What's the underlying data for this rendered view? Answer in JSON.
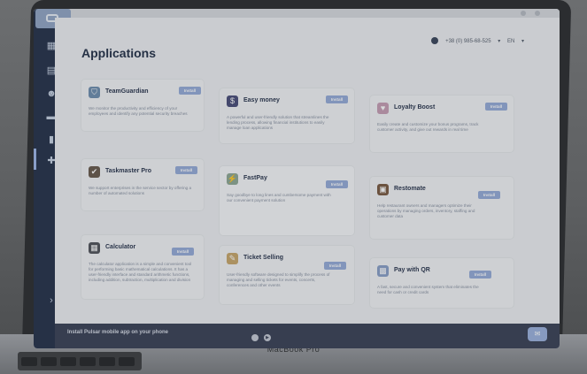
{
  "header": {
    "phone": "+38 (0) 985-68-525",
    "language": "EN"
  },
  "page": {
    "title": "Applications"
  },
  "apps": [
    {
      "name": "TeamGuardian",
      "desc": "We monitor the productivity and efficiency of your employees and identify any potential security breaches",
      "install": "Install",
      "icon": "shield-person-icon",
      "color": "#6f8fb0"
    },
    {
      "name": "Easy money",
      "desc": "A powerful and user-friendly solution that streamlines the lending process, allowing financial institutions to easily manage loan applications",
      "install": "Install",
      "icon": "money-icon",
      "color": "#4b4f7a"
    },
    {
      "name": "Loyalty Boost",
      "desc": "Easily create and customize your bonus programs, track customer activity, and give out rewards in real time",
      "install": "Install",
      "icon": "loyalty-icon",
      "color": "#c79fb5"
    },
    {
      "name": "Taskmaster Pro",
      "desc": "We support enterprises in the service sector by offering a number of automated solutions",
      "install": "Install",
      "icon": "tasks-icon",
      "color": "#6a5b4d"
    },
    {
      "name": "FastPay",
      "desc": "Say goodbye to long lines and cumbersome payment with our convenient payment solution",
      "install": "Install",
      "icon": "fastpay-icon",
      "color": "#8fa995"
    },
    {
      "name": "Restomate",
      "desc": "Help restaurant owners and managers optimize their operations by managing orders, inventory, staffing and customer data",
      "install": "Install",
      "icon": "restaurant-icon",
      "color": "#7a5b43"
    },
    {
      "name": "Calculator",
      "desc": "The calculator application is a simple and convenient tool for performing basic mathematical calculations. It has a user-friendly interface and standard arithmetic functions, including addition, subtraction, multiplication and division",
      "install": "Install",
      "icon": "calculator-icon",
      "color": "#52555c"
    },
    {
      "name": "Ticket Selling",
      "desc": "User-friendly software designed to simplify the process of managing and selling tickets for events, concerts, conferences and other events",
      "install": "Install",
      "icon": "ticket-icon",
      "color": "#c9a86c"
    },
    {
      "name": "Pay with QR",
      "desc": "A fast, secure and convenient system that eliminates the need for cash or credit cards",
      "install": "Install",
      "icon": "qr-icon",
      "color": "#8aa0c9"
    }
  ],
  "footer": {
    "promo": "Install Pulsar mobile app on your phone"
  },
  "device": {
    "label": "MacBook Pro"
  }
}
